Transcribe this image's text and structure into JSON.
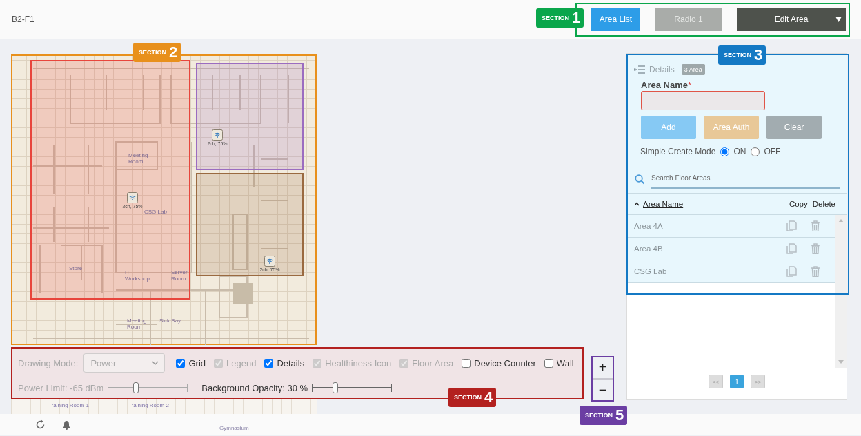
{
  "header": {
    "floor": "B2-F1",
    "buttons": [
      {
        "label": "Area List",
        "kind": "primary"
      },
      {
        "label": "Radio 1",
        "kind": "disabled"
      },
      {
        "label": "Edit Area",
        "kind": "dropdown"
      }
    ]
  },
  "map": {
    "areas": [
      {
        "color": "#e8453c"
      },
      {
        "color": "#9b6cc0"
      },
      {
        "color": "#9a6a40"
      }
    ],
    "devices": [
      {
        "label": "2ch, 75%"
      },
      {
        "label": "2ch, 75%"
      },
      {
        "label": "2ch, 75%"
      }
    ],
    "rooms": [
      {
        "label": "Meeting Room"
      },
      {
        "label": "CSG Lab"
      },
      {
        "label": "Store"
      },
      {
        "label": "IT Workshop"
      },
      {
        "label": "Server Room"
      },
      {
        "label": "Meeting Room"
      },
      {
        "label": "Sick Bay"
      }
    ],
    "lower_rooms": [
      {
        "label": "Training Room 1"
      },
      {
        "label": "Training Room 2"
      }
    ],
    "bottom_room": "Gymnasium"
  },
  "toolbar": {
    "drawing_mode": {
      "label": "Drawing Mode:",
      "value": "Power",
      "disabled": true
    },
    "checkboxes": [
      {
        "label": "Grid",
        "checked": true,
        "disabled": false
      },
      {
        "label": "Legend",
        "checked": true,
        "disabled": true
      },
      {
        "label": "Details",
        "checked": true,
        "disabled": false
      },
      {
        "label": "Healthiness Icon",
        "checked": true,
        "disabled": true
      },
      {
        "label": "Floor Area",
        "checked": true,
        "disabled": true
      },
      {
        "label": "Device Counter",
        "checked": false,
        "disabled": false
      },
      {
        "label": "Wall",
        "checked": false,
        "disabled": false
      }
    ],
    "sliders": [
      {
        "label": "Power Limit: -65 dBm",
        "level": 0.36,
        "disabled": true
      },
      {
        "label": "Background Opacity: 30 %",
        "level": 0.3,
        "disabled": false
      }
    ]
  },
  "zoom": {
    "in": "+",
    "out": "−"
  },
  "panel": {
    "title": "Details",
    "count": "3 Area",
    "field_label": "Area Name",
    "required": "*",
    "buttons": [
      {
        "label": "Add",
        "kind": "add"
      },
      {
        "label": "Area Auth",
        "kind": "auth"
      },
      {
        "label": "Clear",
        "kind": "clear"
      }
    ],
    "mode_label": "Simple Create Mode",
    "mode_options": [
      {
        "label": "ON",
        "selected": true
      },
      {
        "label": "OFF",
        "selected": false
      }
    ],
    "search": {
      "placeholder": "Search Floor Areas"
    },
    "columns": [
      "Area Name",
      "Copy",
      "Delete"
    ],
    "rows": [
      {
        "name": "Area 4A"
      },
      {
        "name": "Area 4B"
      },
      {
        "name": "CSG Lab"
      }
    ],
    "pagination": [
      {
        "label": "<<",
        "selected": false
      },
      {
        "label": "1",
        "selected": true
      },
      {
        "label": ">>",
        "selected": false
      }
    ]
  },
  "annotations": [
    {
      "label": "SECTION",
      "number": "1",
      "color": "#0aa64b"
    },
    {
      "label": "SECTION",
      "number": "2",
      "color": "#e8901c"
    },
    {
      "label": "SECTION",
      "number": "3",
      "color": "#1479c4"
    },
    {
      "label": "SECTION",
      "number": "4",
      "color": "#b3211f"
    },
    {
      "label": "SECTION",
      "number": "5",
      "color": "#6b3ea3"
    }
  ]
}
